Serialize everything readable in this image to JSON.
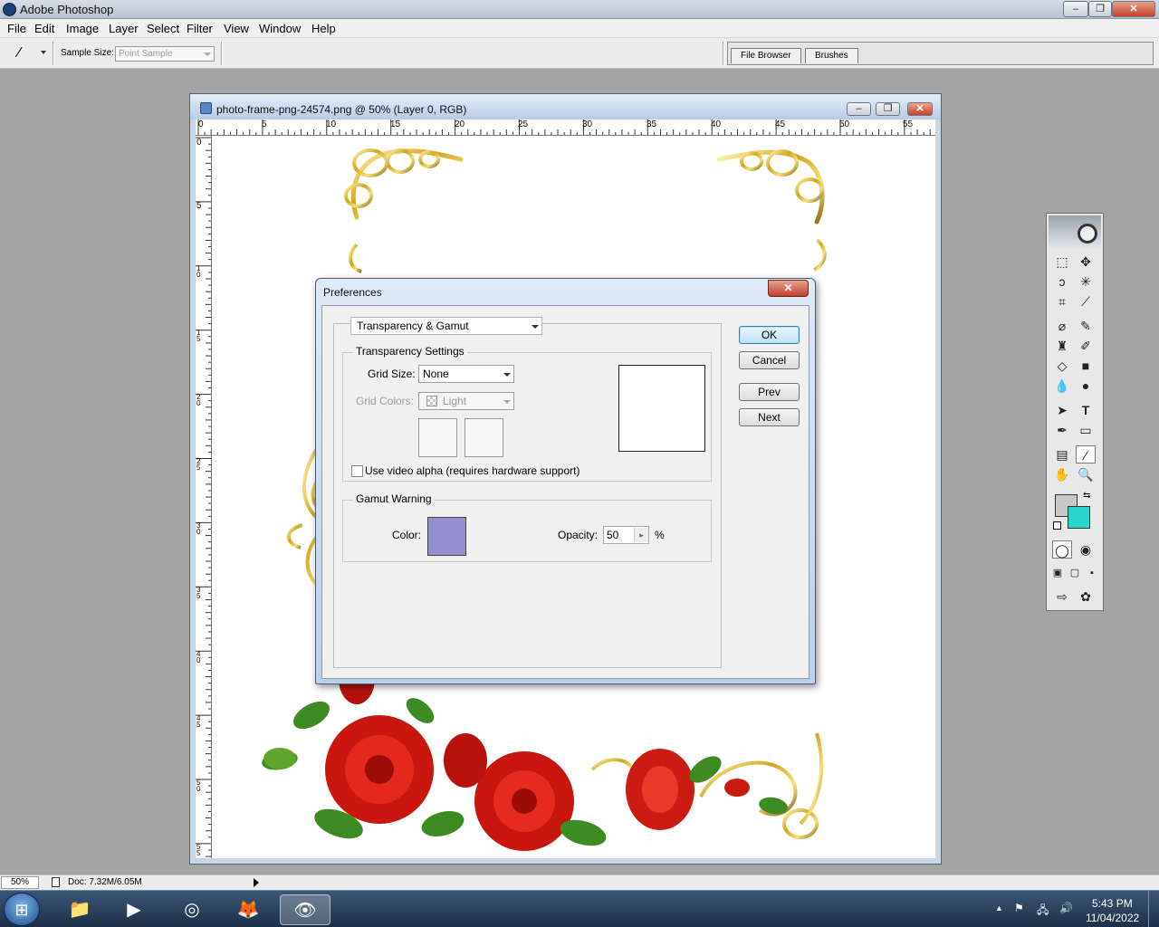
{
  "app": {
    "title": "Adobe Photoshop",
    "menu": [
      "File",
      "Edit",
      "Image",
      "Layer",
      "Select",
      "Filter",
      "View",
      "Window",
      "Help"
    ]
  },
  "options_bar": {
    "sample_size_label": "Sample Size:",
    "sample_size_value": "Point Sample",
    "palette_tabs": [
      "File Browser",
      "Brushes"
    ]
  },
  "document": {
    "title": "photo-frame-png-24574.png @ 50% (Layer 0, RGB)",
    "ruler_top": [
      "0",
      "5",
      "10",
      "15",
      "20",
      "25",
      "30",
      "35",
      "40",
      "45",
      "50",
      "55"
    ],
    "ruler_left": [
      "0",
      "5",
      "10",
      "15",
      "20",
      "25",
      "30",
      "35",
      "40",
      "45",
      "50",
      "55"
    ]
  },
  "preferences": {
    "title": "Preferences",
    "close_label": "✕",
    "section_value": "Transparency & Gamut",
    "transparency": {
      "group_label": "Transparency Settings",
      "grid_size_label": "Grid Size:",
      "grid_size_value": "None",
      "grid_colors_label": "Grid Colors:",
      "grid_colors_value": "Light",
      "video_alpha_label": "Use video alpha (requires hardware support)",
      "video_alpha_checked": false
    },
    "gamut": {
      "group_label": "Gamut Warning",
      "color_label": "Color:",
      "color_value": "#9490d0",
      "opacity_label": "Opacity:",
      "opacity_value": "50",
      "opacity_unit": "%"
    },
    "buttons": {
      "ok": "OK",
      "cancel": "Cancel",
      "prev": "Prev",
      "next": "Next"
    }
  },
  "tools": {
    "foreground_color": "#c8c8c8",
    "background_color": "#2ad6cc"
  },
  "status_bar": {
    "zoom": "50%",
    "doc_info": "Doc: 7.32M/6.05M"
  },
  "taskbar": {
    "time": "5:43 PM",
    "date": "11/04/2022"
  }
}
